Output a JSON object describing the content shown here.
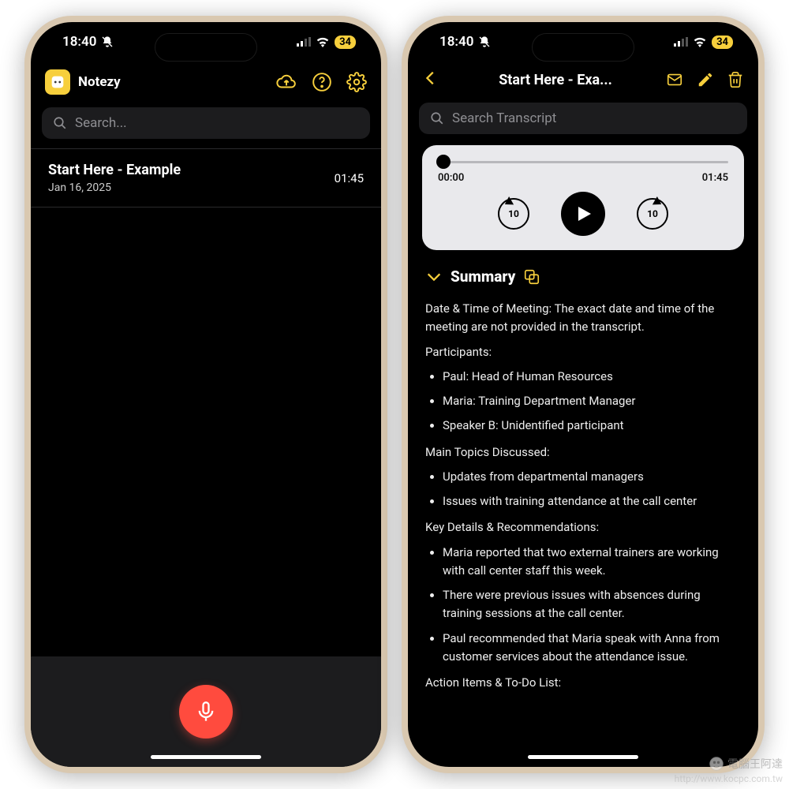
{
  "status": {
    "time": "18:40",
    "battery": "34"
  },
  "left": {
    "appName": "Notezy",
    "searchPlaceholder": "Search...",
    "note": {
      "title": "Start Here - Example",
      "date": "Jan 16, 2025",
      "duration": "01:45"
    }
  },
  "right": {
    "headerTitle": "Start Here - Exa...",
    "searchPlaceholder": "Search Transcript",
    "player": {
      "current": "00:00",
      "total": "01:45",
      "skipSec": "10"
    },
    "sectionTitle": "Summary",
    "summary": {
      "dateTime": "Date & Time of Meeting: The exact date and time of the meeting are not provided in the transcript.",
      "participantsHead": "Participants:",
      "participants": [
        "Paul: Head of Human Resources",
        "Maria: Training Department Manager",
        "Speaker B: Unidentified participant"
      ],
      "topicsHead": "Main Topics Discussed:",
      "topics": [
        "Updates from departmental managers",
        "Issues with training attendance at the call center"
      ],
      "keyHead": "Key Details & Recommendations:",
      "keyDetails": [
        "Maria reported that two external trainers are working with call center staff this week.",
        "There were previous issues with absences during training sessions at the call center.",
        "Paul recommended that Maria speak with Anna from customer services about the attendance issue."
      ],
      "actionsHead": "Action Items & To-Do List:"
    }
  },
  "watermark": {
    "brand": "電腦王阿達",
    "url": "http://www.kocpc.com.tw"
  }
}
